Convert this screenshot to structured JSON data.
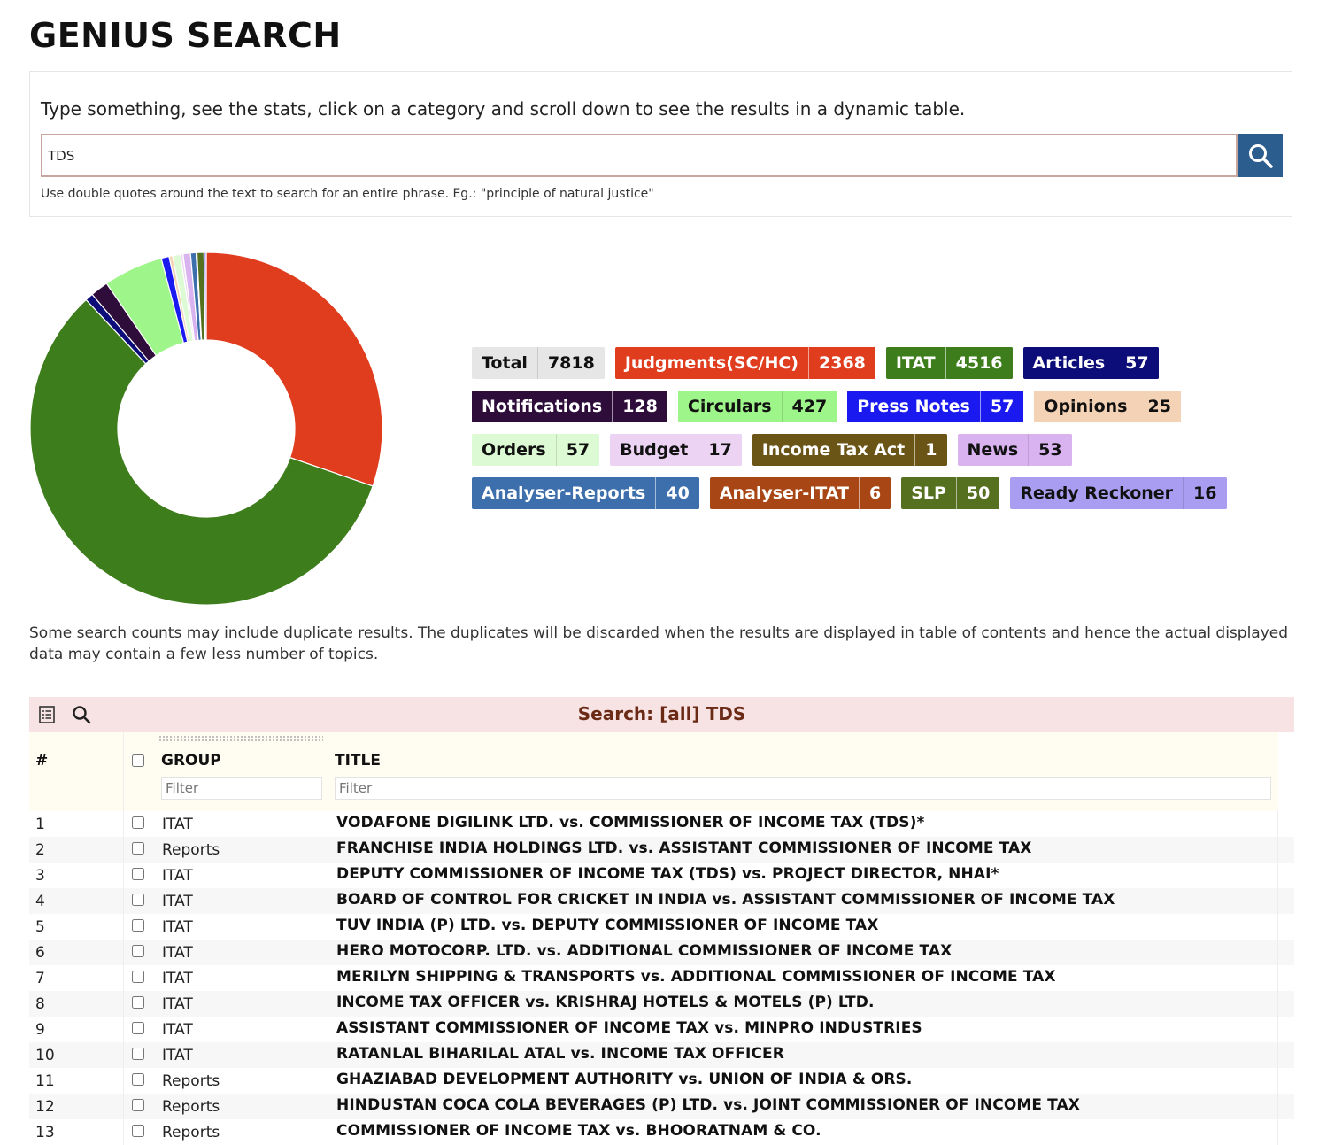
{
  "page": {
    "title": "GENIUS SEARCH"
  },
  "search": {
    "instructions": "Type something, see the stats, click on a category and scroll down to see the results in a dynamic table.",
    "value": "TDS",
    "hint": "Use double quotes around the text to search for an entire phrase. Eg.: \"principle of natural justice\"",
    "button_icon": "search-icon"
  },
  "stats": [
    {
      "label": "Total",
      "count": "7818",
      "bg": "#e6e6e6",
      "cbg": "#e6e6e6",
      "fg": "#111111"
    },
    {
      "label": "Judgments(SC/HC)",
      "count": "2368",
      "bg": "#e03c1e",
      "cbg": "#e03c1e",
      "fg": "#ffffff"
    },
    {
      "label": "ITAT",
      "count": "4516",
      "bg": "#3e7d1c",
      "cbg": "#3e7d1c",
      "fg": "#ffffff"
    },
    {
      "label": "Articles",
      "count": "57",
      "bg": "#0d0d7a",
      "cbg": "#0d0d7a",
      "fg": "#ffffff"
    },
    {
      "label": "Notifications",
      "count": "128",
      "bg": "#2e0d3b",
      "cbg": "#2e0d3b",
      "fg": "#ffffff"
    },
    {
      "label": "Circulars",
      "count": "427",
      "bg": "#9ef58a",
      "cbg": "#9ef58a",
      "fg": "#111111"
    },
    {
      "label": "Press Notes",
      "count": "57",
      "bg": "#1a1af0",
      "cbg": "#1a1af0",
      "fg": "#ffffff"
    },
    {
      "label": "Opinions",
      "count": "25",
      "bg": "#f4d2b5",
      "cbg": "#f4d2b5",
      "fg": "#111111"
    },
    {
      "label": "Orders",
      "count": "57",
      "bg": "#dcfad4",
      "cbg": "#dcfad4",
      "fg": "#111111"
    },
    {
      "label": "Budget",
      "count": "17",
      "bg": "#ecd3f3",
      "cbg": "#ecd3f3",
      "fg": "#111111"
    },
    {
      "label": "Income Tax Act",
      "count": "1",
      "bg": "#6b5516",
      "cbg": "#6b5516",
      "fg": "#ffffff"
    },
    {
      "label": "News",
      "count": "53",
      "bg": "#d8b3f0",
      "cbg": "#d8b3f0",
      "fg": "#111111"
    },
    {
      "label": "Analyser-Reports",
      "count": "40",
      "bg": "#3d6fad",
      "cbg": "#3d6fad",
      "fg": "#ffffff"
    },
    {
      "label": "Analyser-ITAT",
      "count": "6",
      "bg": "#a84715",
      "cbg": "#a84715",
      "fg": "#ffffff"
    },
    {
      "label": "SLP",
      "count": "50",
      "bg": "#55701f",
      "cbg": "#55701f",
      "fg": "#ffffff"
    },
    {
      "label": "Ready Reckoner",
      "count": "16",
      "bg": "#a99df2",
      "cbg": "#a99df2",
      "fg": "#111111"
    }
  ],
  "chart_data": {
    "type": "pie",
    "variant": "donut",
    "total": 7818,
    "slices": [
      {
        "label": "Judgments(SC/HC)",
        "value": 2368,
        "color": "#e03c1e"
      },
      {
        "label": "ITAT",
        "value": 4516,
        "color": "#3e7d1c"
      },
      {
        "label": "Articles",
        "value": 57,
        "color": "#0d0d7a"
      },
      {
        "label": "Notifications",
        "value": 128,
        "color": "#2e0d3b"
      },
      {
        "label": "Circulars",
        "value": 427,
        "color": "#9ef58a"
      },
      {
        "label": "Press Notes",
        "value": 57,
        "color": "#1a1af0"
      },
      {
        "label": "Opinions",
        "value": 25,
        "color": "#f4d2b5"
      },
      {
        "label": "Orders",
        "value": 57,
        "color": "#dcfad4"
      },
      {
        "label": "Budget",
        "value": 17,
        "color": "#ecd3f3"
      },
      {
        "label": "Income Tax Act",
        "value": 1,
        "color": "#6b5516"
      },
      {
        "label": "News",
        "value": 53,
        "color": "#d8b3f0"
      },
      {
        "label": "Analyser-Reports",
        "value": 40,
        "color": "#3d6fad"
      },
      {
        "label": "Analyser-ITAT",
        "value": 6,
        "color": "#a84715"
      },
      {
        "label": "SLP",
        "value": 50,
        "color": "#55701f"
      },
      {
        "label": "Ready Reckoner",
        "value": 16,
        "color": "#a99df2"
      }
    ]
  },
  "note": "Some search counts may include duplicate results. The duplicates will be discarded when the results are displayed in table of contents and hence the actual displayed data may contain a few less number of topics.",
  "table": {
    "title": "Search: [all] TDS",
    "tools": [
      "list-icon",
      "search-icon"
    ],
    "columns": {
      "num": "#",
      "group": "GROUP",
      "title": "TITLE"
    },
    "filter_placeholder": "Filter",
    "rows": [
      {
        "num": "1",
        "group": "ITAT",
        "title": "VODAFONE DIGILINK LTD. vs. COMMISSIONER OF INCOME TAX (TDS)*"
      },
      {
        "num": "2",
        "group": "Reports",
        "title": "FRANCHISE INDIA HOLDINGS LTD. vs. ASSISTANT COMMISSIONER OF INCOME TAX"
      },
      {
        "num": "3",
        "group": "ITAT",
        "title": "DEPUTY COMMISSIONER OF INCOME TAX (TDS) vs. PROJECT DIRECTOR, NHAI*"
      },
      {
        "num": "4",
        "group": "ITAT",
        "title": "BOARD OF CONTROL FOR CRICKET IN INDIA vs. ASSISTANT COMMISSIONER OF INCOME TAX"
      },
      {
        "num": "5",
        "group": "ITAT",
        "title": "TUV INDIA (P) LTD. vs. DEPUTY COMMISSIONER OF INCOME TAX"
      },
      {
        "num": "6",
        "group": "ITAT",
        "title": "HERO MOTOCORP. LTD. vs. ADDITIONAL COMMISSIONER OF INCOME TAX"
      },
      {
        "num": "7",
        "group": "ITAT",
        "title": "MERILYN SHIPPING & TRANSPORTS vs. ADDITIONAL COMMISSIONER OF INCOME TAX"
      },
      {
        "num": "8",
        "group": "ITAT",
        "title": "INCOME TAX OFFICER vs. KRISHRAJ HOTELS & MOTELS (P) LTD."
      },
      {
        "num": "9",
        "group": "ITAT",
        "title": "ASSISTANT COMMISSIONER OF INCOME TAX vs. MINPRO INDUSTRIES"
      },
      {
        "num": "10",
        "group": "ITAT",
        "title": "RATANLAL BIHARILAL ATAL vs. INCOME TAX OFFICER"
      },
      {
        "num": "11",
        "group": "Reports",
        "title": "GHAZIABAD DEVELOPMENT AUTHORITY vs. UNION OF INDIA & ORS."
      },
      {
        "num": "12",
        "group": "Reports",
        "title": "HINDUSTAN COCA COLA BEVERAGES (P) LTD. vs. JOINT COMMISSIONER OF INCOME TAX"
      },
      {
        "num": "13",
        "group": "Reports",
        "title": "COMMISSIONER OF INCOME TAX vs. BHOORATNAM & CO."
      }
    ]
  }
}
